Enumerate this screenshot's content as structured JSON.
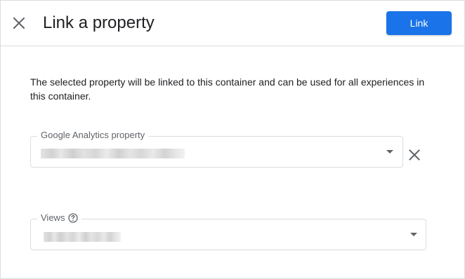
{
  "header": {
    "title": "Link a property",
    "link_label": "Link"
  },
  "description": "The selected property will be linked to this container and can be used for all experiences in this container.",
  "property_field": {
    "label": "Google Analytics property"
  },
  "views_field": {
    "label": "Views"
  },
  "colors": {
    "primary": "#1a73e8",
    "border": "#dadce0",
    "icon": "#5f6368"
  },
  "icons": [
    "close-icon",
    "dropdown-arrow-icon",
    "clear-icon",
    "help-icon"
  ]
}
